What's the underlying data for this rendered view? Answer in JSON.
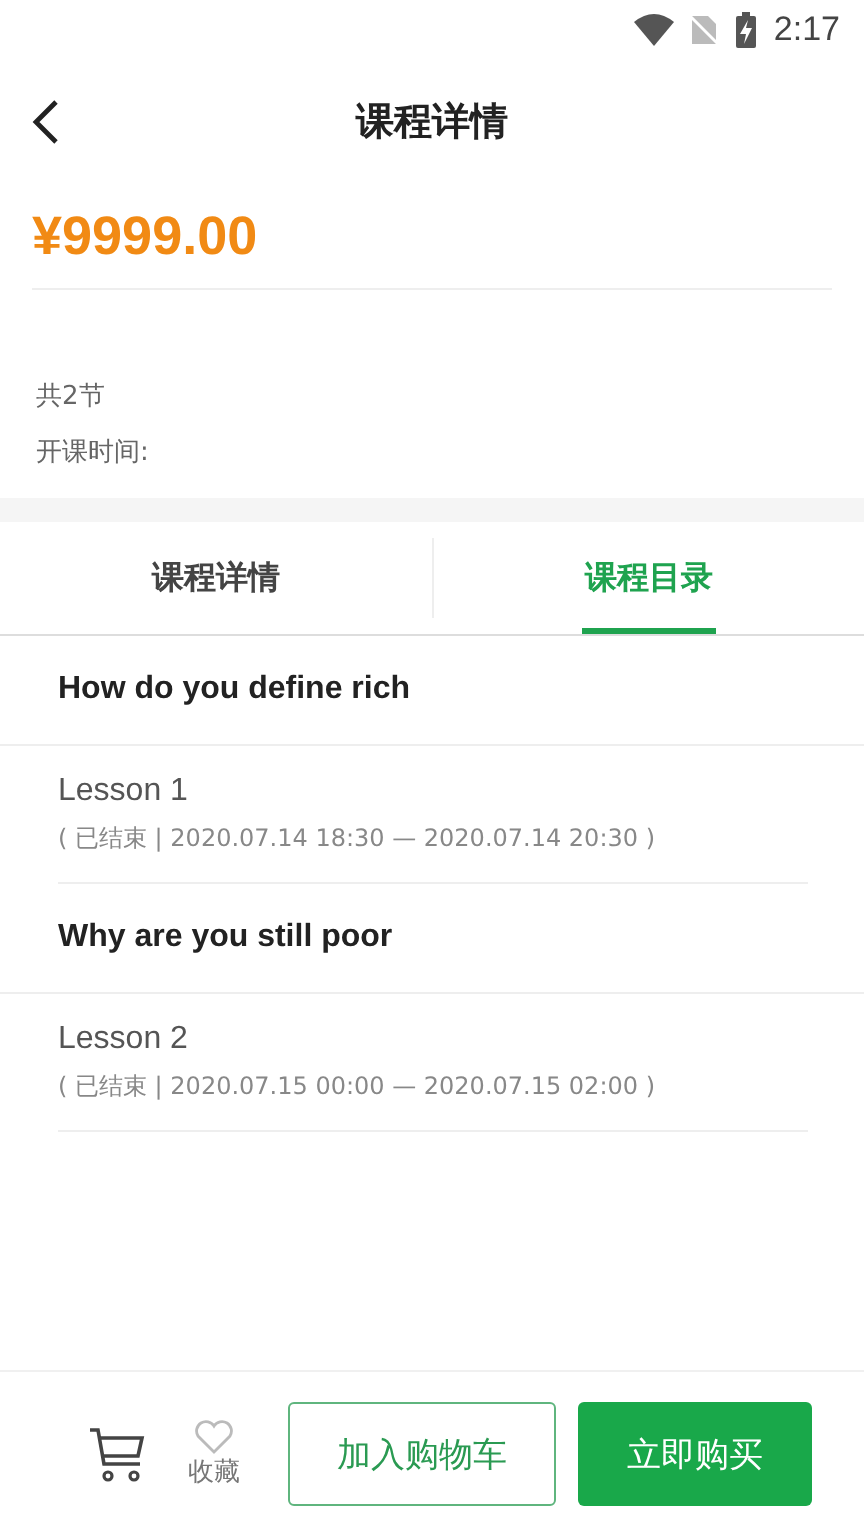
{
  "status_bar": {
    "time": "2:17"
  },
  "header": {
    "title": "课程详情"
  },
  "price": "¥9999.00",
  "info": {
    "count": "共2节",
    "start_time_label": "开课时间:"
  },
  "tabs": [
    {
      "label": "课程详情",
      "selected": false
    },
    {
      "label": "课程目录",
      "selected": true
    }
  ],
  "chapters": [
    {
      "title": "How do you define rich",
      "lessons": [
        {
          "title": "Lesson 1",
          "detail": "( 已结束 | 2020.07.14 18:30 — 2020.07.14 20:30 )"
        }
      ]
    },
    {
      "title": "Why are you still poor",
      "lessons": [
        {
          "title": "Lesson 2",
          "detail": "( 已结束 | 2020.07.15 00:00 — 2020.07.15 02:00 )"
        }
      ]
    }
  ],
  "bottom_bar": {
    "favorite": {
      "label": "收藏",
      "on": false
    },
    "add_to_cart": "加入购物车",
    "buy_now": "立即购买"
  }
}
